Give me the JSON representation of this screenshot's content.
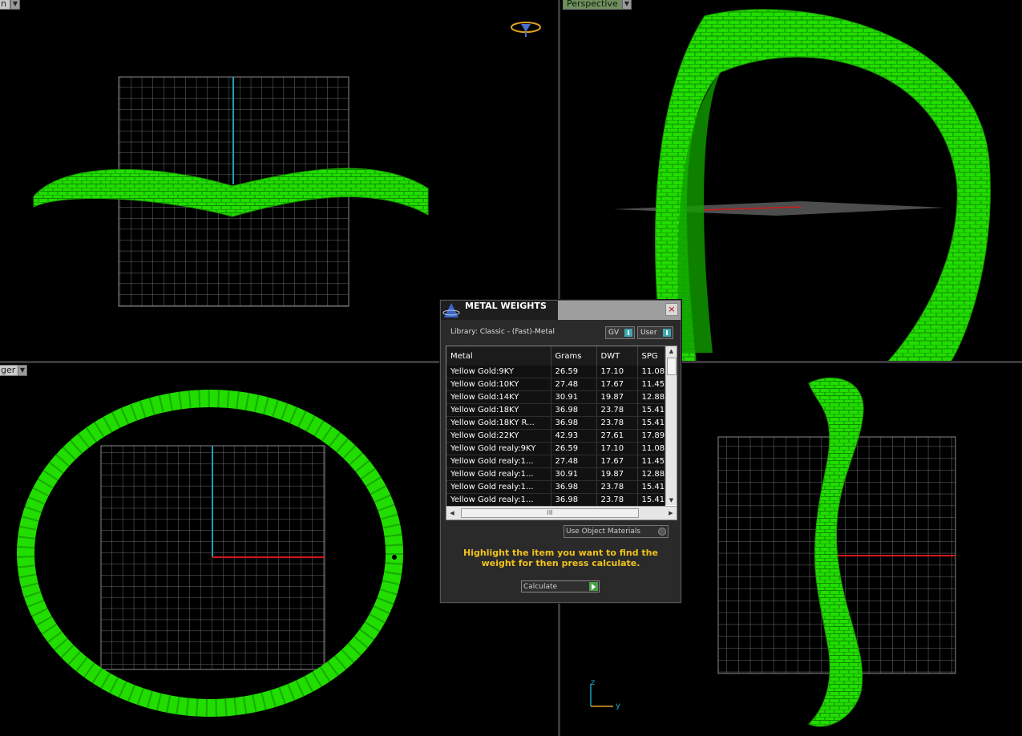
{
  "viewports": {
    "top_left": {
      "tab_label": "n"
    },
    "top_right": {
      "tab_label": "Perspective"
    },
    "bottom_left": {
      "tab_label": "ger"
    }
  },
  "dialog": {
    "title": "METAL WEIGHTS",
    "library_label": "Library: Classic - (Fast)-Metal",
    "toggle_gv": "GV",
    "toggle_user": "User",
    "columns": [
      "Metal",
      "Grams",
      "DWT",
      "SPG"
    ],
    "rows": [
      [
        "Yellow Gold:9KY",
        "26.59",
        "17.10",
        "11.08"
      ],
      [
        "Yellow Gold:10KY",
        "27.48",
        "17.67",
        "11.45"
      ],
      [
        "Yellow Gold:14KY",
        "30.91",
        "19.87",
        "12.88"
      ],
      [
        "Yellow Gold:18KY",
        "36.98",
        "23.78",
        "15.41"
      ],
      [
        "Yellow Gold:18KY R...",
        "36.98",
        "23.78",
        "15.41"
      ],
      [
        "Yellow Gold:22KY",
        "42.93",
        "27.61",
        "17.89"
      ],
      [
        "Yellow Gold realy:9KY",
        "26.59",
        "17.10",
        "11.08"
      ],
      [
        "Yellow Gold realy:1...",
        "27.48",
        "17.67",
        "11.45"
      ],
      [
        "Yellow Gold realy:1...",
        "30.91",
        "19.87",
        "12.88"
      ],
      [
        "Yellow Gold realy:1...",
        "36.98",
        "23.78",
        "15.41"
      ],
      [
        "Yellow Gold realy:1...",
        "36.98",
        "23.78",
        "15.41"
      ]
    ],
    "scroll_thumb_glyph": "III",
    "use_object_materials": "Use Object Materials",
    "hint": "Highlight the item you want to find the weight for then press calculate.",
    "calculate_label": "Calculate",
    "close_glyph": "×"
  },
  "axis_labels": {
    "z": "z",
    "y": "y"
  },
  "colors": {
    "model_green": "#22dd00",
    "grid": "#7a7a7a",
    "axis_red": "#d01818",
    "axis_cyan": "#1aa0b8",
    "hint_yellow": "#f0c21c"
  }
}
